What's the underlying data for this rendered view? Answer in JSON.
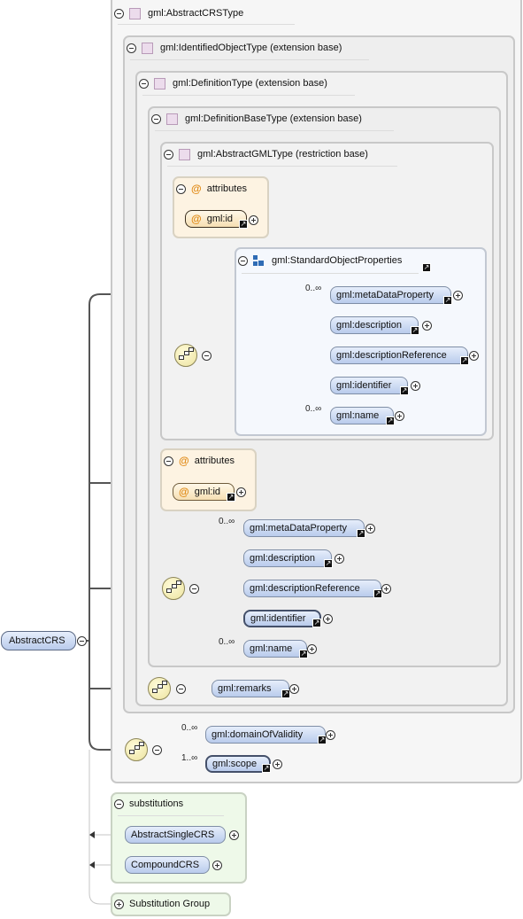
{
  "root": {
    "label": "AbstractCRS"
  },
  "types": {
    "abstract_crs_type": "gml:AbstractCRSType",
    "identified_object_type": "gml:IdentifiedObjectType (extension base)",
    "definition_type": "gml:DefinitionType (extension base)",
    "definition_base_type": "gml:DefinitionBaseType (extension base)",
    "abstract_gml_type": "gml:AbstractGMLType (restriction base)"
  },
  "attributes_label": "attributes",
  "attr_icon": "@",
  "attr_id": "gml:id",
  "group": {
    "label": "gml:StandardObjectProperties"
  },
  "inner_sequence": [
    {
      "label": "gml:metaDataProperty",
      "occurs": "0..∞"
    },
    {
      "label": "gml:description",
      "occurs": ""
    },
    {
      "label": "gml:descriptionReference",
      "occurs": ""
    },
    {
      "label": "gml:identifier",
      "occurs": ""
    },
    {
      "label": "gml:name",
      "occurs": "0..∞"
    }
  ],
  "outer_sequence": [
    {
      "label": "gml:metaDataProperty",
      "occurs": "0..∞"
    },
    {
      "label": "gml:description",
      "occurs": ""
    },
    {
      "label": "gml:descriptionReference",
      "occurs": ""
    },
    {
      "label": "gml:identifier",
      "occurs": ""
    },
    {
      "label": "gml:name",
      "occurs": "0..∞"
    }
  ],
  "remarks": "gml:remarks",
  "crs_sequence": [
    {
      "label": "gml:domainOfValidity",
      "occurs": "0..∞"
    },
    {
      "label": "gml:scope",
      "occurs": "1..∞"
    }
  ],
  "substitutions": {
    "label": "substitutions",
    "items": [
      "AbstractSingleCRS",
      "CompoundCRS"
    ]
  },
  "substitution_group": "Substitution Group",
  "colors": {
    "element_fill": "#c7d6f1",
    "attribute_fill": "#fbe8c3",
    "compositor_fill": "#f3ecbb",
    "substitution_fill": "#eef9e9"
  }
}
